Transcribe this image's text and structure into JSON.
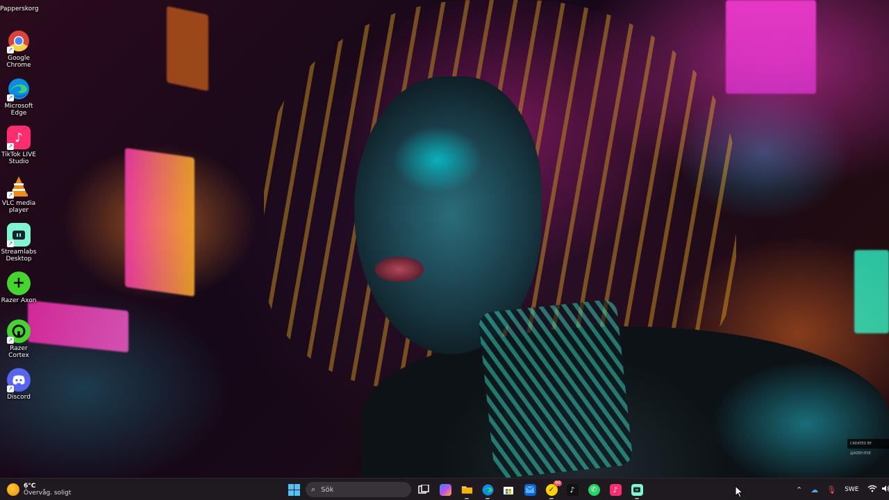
{
  "desktop": {
    "recycle_bin": "Papperskorg",
    "icons": [
      {
        "label": "Google Chrome",
        "icon": "chrome-icon",
        "color": "#4285f4"
      },
      {
        "label": "Microsoft Edge",
        "icon": "edge-icon",
        "color": "#0c8ce0"
      },
      {
        "label": "TikTok LIVE Studio",
        "icon": "tiktok-live-studio-icon",
        "color": "#ff2d6f"
      },
      {
        "label": "VLC media player",
        "icon": "vlc-icon",
        "color": "#f08a10"
      },
      {
        "label": "Streamlabs Desktop",
        "icon": "streamlabs-icon",
        "color": "#80f5d2"
      },
      {
        "label": "Razer Axon",
        "icon": "razer-axon-icon",
        "color": "#44d62c"
      },
      {
        "label": "Razer Cortex",
        "icon": "razer-cortex-icon",
        "color": "#44d62c"
      },
      {
        "label": "Discord",
        "icon": "discord-icon",
        "color": "#5865f2"
      }
    ]
  },
  "wallpaper": {
    "watermark": "CREATED BY @AZEH.EXE"
  },
  "taskbar": {
    "weather": {
      "temp": "6°C",
      "condition": "Övervåg. soligt"
    },
    "search_placeholder": "Sök",
    "apps": [
      {
        "name": "task-view",
        "icon": "task-view-icon"
      },
      {
        "name": "copilot",
        "icon": "copilot-icon"
      },
      {
        "name": "file-explorer",
        "icon": "folder-icon"
      },
      {
        "name": "edge",
        "icon": "edge-icon"
      },
      {
        "name": "microsoft-store",
        "icon": "store-icon"
      },
      {
        "name": "outlook",
        "icon": "outlook-icon"
      },
      {
        "name": "norton",
        "icon": "norton-icon",
        "badge": "99"
      },
      {
        "name": "tiktok",
        "icon": "tiktok-icon"
      },
      {
        "name": "whatsapp",
        "icon": "whatsapp-icon"
      },
      {
        "name": "tiktok-live-studio",
        "icon": "tiktok-live-studio-icon"
      },
      {
        "name": "streamlabs",
        "icon": "streamlabs-icon"
      }
    ],
    "tray": {
      "language": "SWE"
    }
  }
}
